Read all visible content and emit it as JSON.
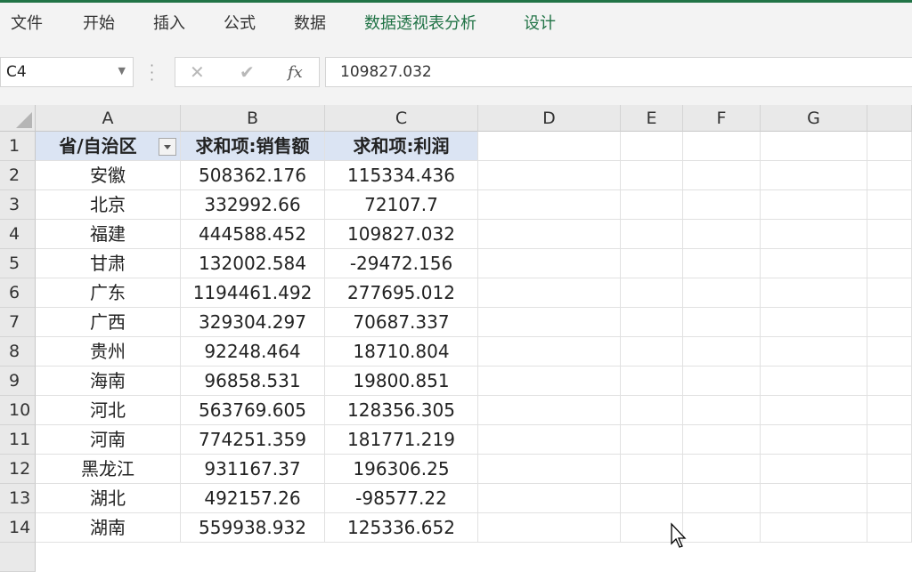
{
  "ribbon": {
    "tabs": [
      {
        "label": "文件",
        "contextual": false
      },
      {
        "label": "开始",
        "contextual": false
      },
      {
        "label": "插入",
        "contextual": false
      },
      {
        "label": "公式",
        "contextual": false
      },
      {
        "label": "数据",
        "contextual": false
      },
      {
        "label": "数据透视表分析",
        "contextual": true
      },
      {
        "label": "设计",
        "contextual": true
      }
    ],
    "accent_color": "#217346"
  },
  "formula_bar": {
    "name_box": "C4",
    "cancel_icon": "x-icon",
    "enter_icon": "check-icon",
    "fx_label": "fx",
    "formula_value": "109827.032"
  },
  "sheet": {
    "columns": [
      "A",
      "B",
      "C",
      "D",
      "E",
      "F",
      "G"
    ],
    "row_numbers": [
      "1",
      "2",
      "3",
      "4",
      "5",
      "6",
      "7",
      "8",
      "9",
      "10",
      "11",
      "12",
      "13",
      "14"
    ],
    "pivot_header": [
      "省/自治区",
      "求和项:销售额",
      "求和项:利润"
    ],
    "rows": [
      [
        "安徽",
        "508362.176",
        "115334.436"
      ],
      [
        "北京",
        "332992.66",
        "72107.7"
      ],
      [
        "福建",
        "444588.452",
        "109827.032"
      ],
      [
        "甘肃",
        "132002.584",
        "-29472.156"
      ],
      [
        "广东",
        "1194461.492",
        "277695.012"
      ],
      [
        "广西",
        "329304.297",
        "70687.337"
      ],
      [
        "贵州",
        "92248.464",
        "18710.804"
      ],
      [
        "海南",
        "96858.531",
        "19800.851"
      ],
      [
        "河北",
        "563769.605",
        "128356.305"
      ],
      [
        "河南",
        "774251.359",
        "181771.219"
      ],
      [
        "黑龙江",
        "931167.37",
        "196306.25"
      ],
      [
        "湖北",
        "492157.26",
        "-98577.22"
      ],
      [
        "湖南",
        "559938.932",
        "125336.652"
      ]
    ],
    "pivot_header_color": "#dbe4f3"
  }
}
